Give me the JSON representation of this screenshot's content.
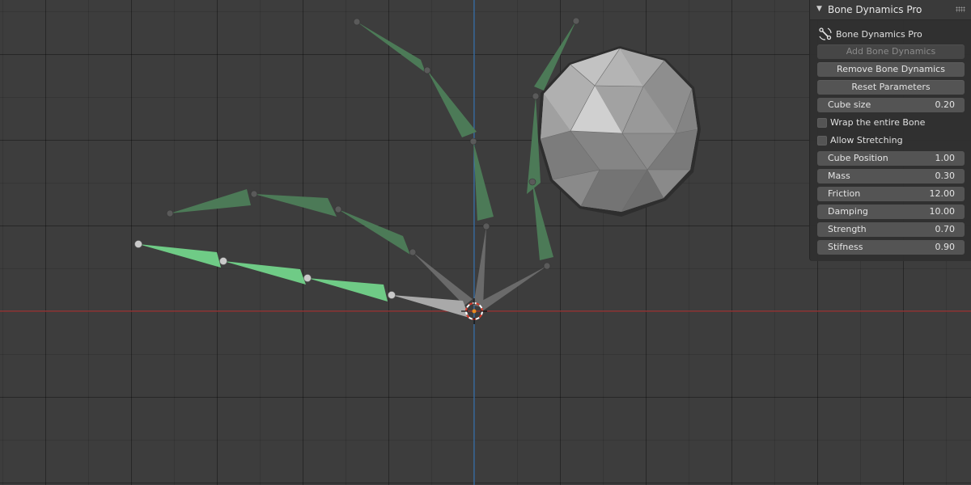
{
  "panel": {
    "header_title": "Bone Dynamics Pro",
    "addon_title": "Bone Dynamics Pro",
    "add_button": "Add Bone Dynamics",
    "remove_button": "Remove Bone Dynamics",
    "reset_button": "Reset Parameters",
    "cube_size": {
      "label": "Cube size",
      "value": "0.20"
    },
    "wrap_bone": {
      "label": "Wrap the entire Bone",
      "checked": false
    },
    "allow_stretching": {
      "label": "Allow Stretching",
      "checked": false
    },
    "cube_position": {
      "label": "Cube Position",
      "value": "1.00"
    },
    "mass": {
      "label": "Mass",
      "value": "0.30"
    },
    "friction": {
      "label": "Friction",
      "value": "12.00"
    },
    "damping": {
      "label": "Damping",
      "value": "10.00"
    },
    "strength": {
      "label": "Strength",
      "value": "0.70"
    },
    "stiffness": {
      "label": "Stifness",
      "value": "0.90"
    }
  },
  "colors": {
    "viewport_bg": "#3d3d3d",
    "x_axis": "#a33a3a",
    "y_axis": "#3e7ab8",
    "bone_active": "#6fcb86",
    "bone_dynamic": "#4c7a57",
    "bone_root": "#a9a9a9",
    "sphere": "#9e9e9e",
    "panel_bg": "#303030"
  },
  "icons": {
    "panel_collapse": "triangle-down-icon",
    "addon": "bone-tool-icon",
    "grip": "drag-handle-icon",
    "cursor": "3d-cursor-icon"
  }
}
